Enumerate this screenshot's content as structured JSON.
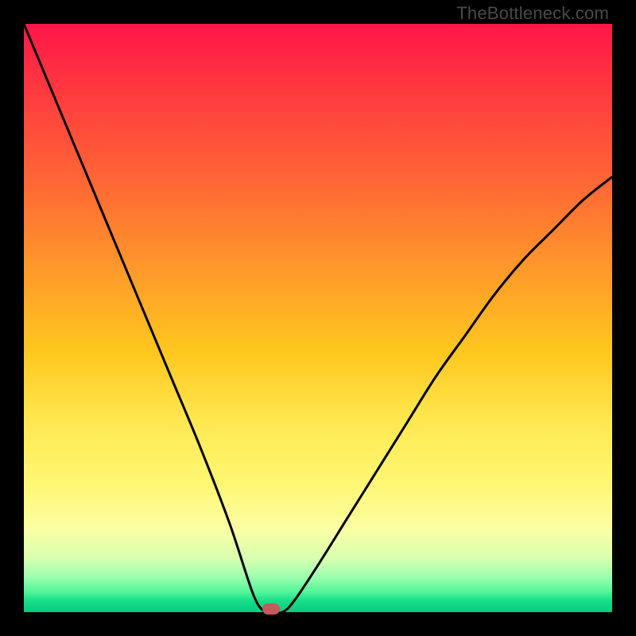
{
  "watermark": "TheBottleneck.com",
  "chart_data": {
    "type": "line",
    "title": "",
    "xlabel": "",
    "ylabel": "",
    "xlim": [
      0,
      100
    ],
    "ylim": [
      0,
      100
    ],
    "series": [
      {
        "name": "bottleneck-curve",
        "x": [
          0,
          5,
          10,
          15,
          20,
          25,
          30,
          35,
          39,
          41,
          42,
          44,
          46,
          50,
          55,
          60,
          65,
          70,
          75,
          80,
          85,
          90,
          95,
          100
        ],
        "values": [
          100,
          88,
          76,
          64,
          52,
          40,
          28,
          15,
          3,
          0,
          0,
          0,
          2,
          8,
          16,
          24,
          32,
          40,
          47,
          54,
          60,
          65,
          70,
          74
        ]
      }
    ],
    "annotations": [
      {
        "name": "min-marker",
        "x": 42,
        "y": 0.5
      }
    ],
    "background_gradient": {
      "direction": "top-to-bottom",
      "stops": [
        {
          "pos": 0,
          "color": "#ff1648"
        },
        {
          "pos": 50,
          "color": "#ffc81f"
        },
        {
          "pos": 85,
          "color": "#fbffa5"
        },
        {
          "pos": 100,
          "color": "#09c97e"
        }
      ]
    }
  }
}
